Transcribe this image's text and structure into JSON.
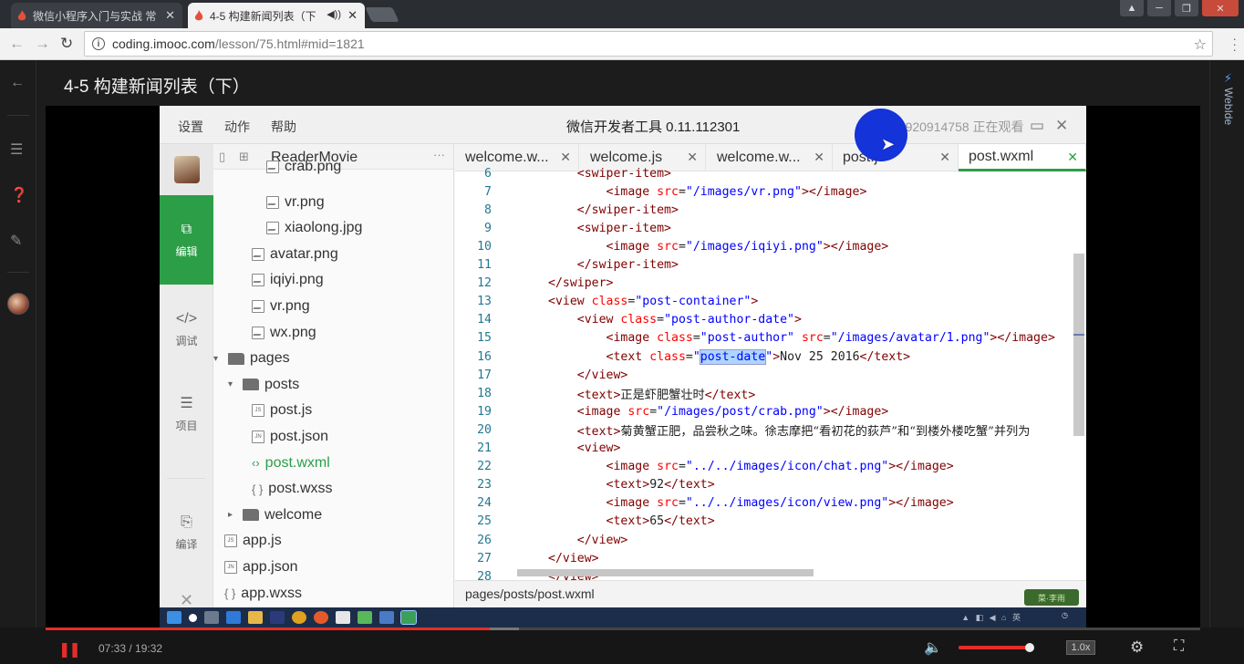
{
  "browser": {
    "tabs": [
      {
        "title": "微信小程序入门与实战 常",
        "active": false
      },
      {
        "title": "4-5 构建新闻列表（下",
        "active": true
      }
    ],
    "url_host": "coding.imooc.com",
    "url_path": "/lesson/75.html#mid=1821"
  },
  "lesson": {
    "title": "4-5 构建新闻列表（下）"
  },
  "rightrail": {
    "label": "WebIde"
  },
  "ide": {
    "menu": [
      "设置",
      "动作",
      "帮助"
    ],
    "title": "微信开发者工具 0.11.112301",
    "user": "15920914758 正在观看",
    "nav": [
      {
        "label": "编辑",
        "icon": "edit-icon",
        "active": true
      },
      {
        "label": "调试",
        "icon": "debug-icon",
        "active": false
      },
      {
        "label": "项目",
        "icon": "project-icon",
        "active": false
      },
      {
        "label": "编译",
        "icon": "compile-icon",
        "active": false
      }
    ],
    "project": "ReaderMovie",
    "tree": [
      {
        "name": "crab.png",
        "type": "image",
        "depth": 3
      },
      {
        "name": "vr.png",
        "type": "image",
        "depth": 3
      },
      {
        "name": "xiaolong.jpg",
        "type": "image",
        "depth": 3
      },
      {
        "name": "avatar.png",
        "type": "image",
        "depth": 2
      },
      {
        "name": "iqiyi.png",
        "type": "image",
        "depth": 2
      },
      {
        "name": "vr.png",
        "type": "image",
        "depth": 2
      },
      {
        "name": "wx.png",
        "type": "image",
        "depth": 2
      },
      {
        "name": "pages",
        "type": "folder-open",
        "depth": 0
      },
      {
        "name": "posts",
        "type": "folder-open",
        "depth": 1
      },
      {
        "name": "post.js",
        "type": "js",
        "depth": 2
      },
      {
        "name": "post.json",
        "type": "json",
        "depth": 2
      },
      {
        "name": "post.wxml",
        "type": "wxml",
        "depth": 2,
        "active": true
      },
      {
        "name": "post.wxss",
        "type": "wxss",
        "depth": 2
      },
      {
        "name": "welcome",
        "type": "folder-closed",
        "depth": 1
      },
      {
        "name": "app.js",
        "type": "js",
        "depth": 0
      },
      {
        "name": "app.json",
        "type": "json",
        "depth": 0
      },
      {
        "name": "app.wxss",
        "type": "wxss",
        "depth": 0
      }
    ],
    "editor_tabs": [
      {
        "label": "welcome.w...",
        "active": false
      },
      {
        "label": "welcome.js",
        "active": false
      },
      {
        "label": "welcome.w...",
        "active": false
      },
      {
        "label": "post.js",
        "active": false
      },
      {
        "label": "post.wxml",
        "active": true
      }
    ],
    "code": [
      {
        "n": "6",
        "text": "        <swiper-item>"
      },
      {
        "n": "7",
        "text": "            <image src=\"/images/vr.png\"></image>"
      },
      {
        "n": "8",
        "text": "        </swiper-item>"
      },
      {
        "n": "9",
        "text": "        <swiper-item>"
      },
      {
        "n": "10",
        "text": "            <image src=\"/images/iqiyi.png\"></image>"
      },
      {
        "n": "11",
        "text": "        </swiper-item>"
      },
      {
        "n": "12",
        "text": "    </swiper>"
      },
      {
        "n": "13",
        "text": "    <view class=\"post-container\">"
      },
      {
        "n": "14",
        "text": "        <view class=\"post-author-date\">"
      },
      {
        "n": "15",
        "text": "            <image class=\"post-author\" src=\"/images/avatar/1.png\"></image>"
      },
      {
        "n": "16",
        "text": "            <text class=\"post-date\">Nov 25 2016</text>"
      },
      {
        "n": "17",
        "text": "        </view>"
      },
      {
        "n": "18",
        "text": "        <text>正是虾肥蟹壮时</text>"
      },
      {
        "n": "19",
        "text": "        <image src=\"/images/post/crab.png\"></image>"
      },
      {
        "n": "20",
        "text": "        <text>菊黄蟹正肥，品尝秋之味。徐志摩把“看初花的荻芦”和“到楼外楼吃蟹”并列为"
      },
      {
        "n": "21",
        "text": "        <view>"
      },
      {
        "n": "22",
        "text": "            <image src=\"../../images/icon/chat.png\"></image>"
      },
      {
        "n": "23",
        "text": "            <text>92</text>"
      },
      {
        "n": "24",
        "text": "            <image src=\"../../images/icon/view.png\"></image>"
      },
      {
        "n": "25",
        "text": "            <text>65</text>"
      },
      {
        "n": "26",
        "text": "        </view>"
      },
      {
        "n": "27",
        "text": "    </view>"
      },
      {
        "n": "28",
        "text": "</view>"
      }
    ],
    "status_path": "pages/posts/post.wxml",
    "watermark": "菜·李雨"
  },
  "player": {
    "time_current": "07:33",
    "time_total": "19:32",
    "progress": 0.385,
    "buffered": 0.41,
    "volume": 0.97,
    "speed": "1.0x"
  }
}
